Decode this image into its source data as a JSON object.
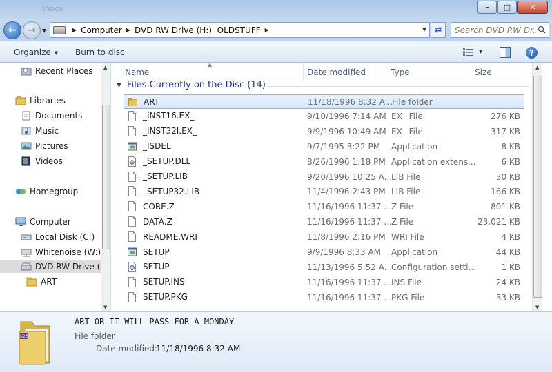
{
  "window": {
    "title_ghost": "Inbox"
  },
  "buttons": {
    "minimize": "–",
    "maximize": "□",
    "close": "✕"
  },
  "address": {
    "crumbs": [
      "Computer",
      "DVD RW Drive (H:)  OLDSTUFF"
    ],
    "search_placeholder": "Search DVD RW Dr..."
  },
  "toolbar": {
    "organize": "Organize",
    "burn": "Burn to disc"
  },
  "nav": {
    "recent_places": "Recent Places",
    "libraries": "Libraries",
    "documents": "Documents",
    "music": "Music",
    "pictures": "Pictures",
    "videos": "Videos",
    "homegroup": "Homegroup",
    "computer": "Computer",
    "local_disk": "Local Disk (C:)",
    "whitenoise": "Whitenoise (W:)",
    "dvd": "DVD RW Drive (H",
    "art": "ART"
  },
  "columns": {
    "name": "Name",
    "date": "Date modified",
    "type": "Type",
    "size": "Size"
  },
  "group": {
    "label": "Files Currently on the Disc (14)"
  },
  "files": [
    {
      "icon": "folder-icon",
      "name": "ART",
      "date": "11/18/1996 8:32 A...",
      "type": "File folder",
      "size": ""
    },
    {
      "icon": "file-icon",
      "name": "_INST16.EX_",
      "date": "9/10/1996 7:14 AM",
      "type": "EX_ File",
      "size": "276 KB"
    },
    {
      "icon": "file-icon",
      "name": "_INST32I.EX_",
      "date": "9/9/1996 10:49 AM",
      "type": "EX_ File",
      "size": "317 KB"
    },
    {
      "icon": "application-icon",
      "name": "_ISDEL",
      "date": "9/7/1995 3:22 PM",
      "type": "Application",
      "size": "8 KB"
    },
    {
      "icon": "dll-icon",
      "name": "_SETUP.DLL",
      "date": "8/26/1996 1:18 PM",
      "type": "Application extens...",
      "size": "6 KB"
    },
    {
      "icon": "file-icon",
      "name": "_SETUP.LIB",
      "date": "9/20/1996 10:25 A...",
      "type": "LIB File",
      "size": "30 KB"
    },
    {
      "icon": "file-icon",
      "name": "_SETUP32.LIB",
      "date": "11/4/1996 2:43 PM",
      "type": "LIB File",
      "size": "166 KB"
    },
    {
      "icon": "file-icon",
      "name": "CORE.Z",
      "date": "11/16/1996 11:37 ...",
      "type": "Z File",
      "size": "801 KB"
    },
    {
      "icon": "file-icon",
      "name": "DATA.Z",
      "date": "11/16/1996 11:37 ...",
      "type": "Z File",
      "size": "23,021 KB"
    },
    {
      "icon": "file-icon",
      "name": "README.WRI",
      "date": "11/8/1996 2:16 PM",
      "type": "WRI File",
      "size": "4 KB"
    },
    {
      "icon": "application-icon",
      "name": "SETUP",
      "date": "9/9/1996 8:33 AM",
      "type": "Application",
      "size": "44 KB"
    },
    {
      "icon": "settings-file-icon",
      "name": "SETUP",
      "date": "11/13/1996 5:52 A...",
      "type": "Configuration setti...",
      "size": "1 KB"
    },
    {
      "icon": "file-icon",
      "name": "SETUP.INS",
      "date": "11/16/1996 11:37 ...",
      "type": "INS File",
      "size": "24 KB"
    },
    {
      "icon": "file-icon",
      "name": "SETUP.PKG",
      "date": "11/16/1996 11:37 ...",
      "type": "PKG File",
      "size": "33 KB"
    }
  ],
  "details": {
    "title": "ART OR IT WILL PASS FOR A MONDAY",
    "type": "File folder",
    "modified_label": "Date modified:",
    "modified_value": "11/18/1996 8:32 AM",
    "folder_badge": "K2B"
  },
  "colors": {
    "folder": "#e8c659",
    "selection": "#d6e8fb",
    "group_text": "#1e3287"
  }
}
